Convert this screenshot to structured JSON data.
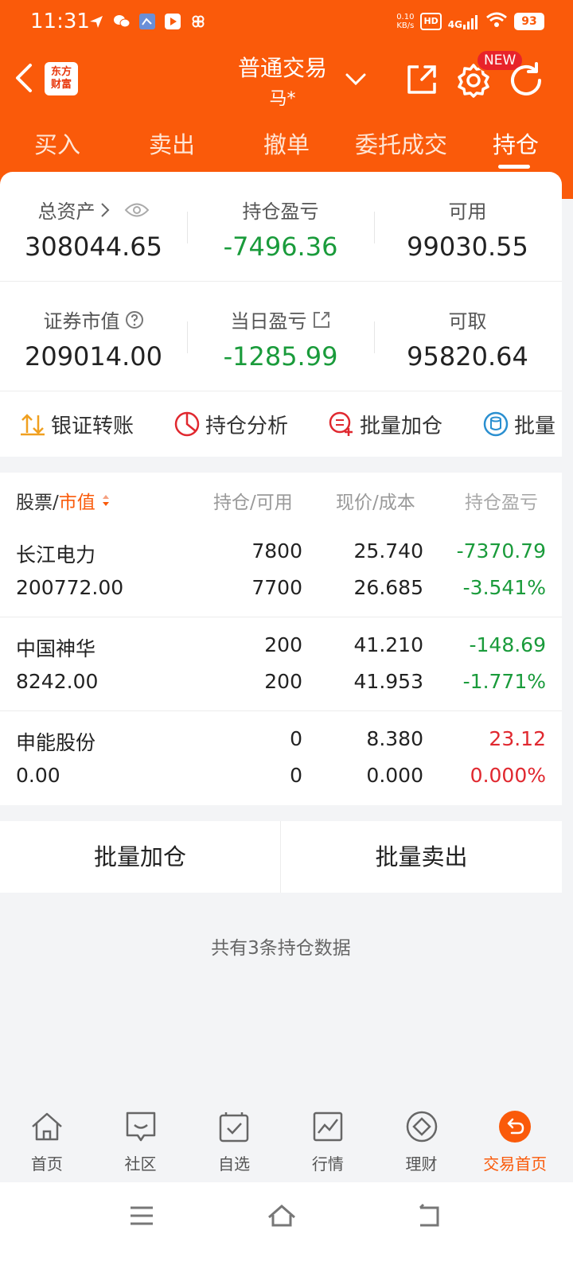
{
  "status": {
    "time": "11:31",
    "net_speed_value": "0.10",
    "net_speed_unit": "KB/s",
    "hd": "HD",
    "network": "4G",
    "battery": "93"
  },
  "nav": {
    "logo_line1": "东方",
    "logo_line2": "财富",
    "title": "普通交易",
    "subtitle": "马*",
    "new_badge": "NEW"
  },
  "tabs": [
    {
      "label": "买入"
    },
    {
      "label": "卖出"
    },
    {
      "label": "撤单"
    },
    {
      "label": "委托成交"
    },
    {
      "label": "持仓"
    }
  ],
  "assets": {
    "total_label": "总资产",
    "total_value": "308044.65",
    "pl_label": "持仓盈亏",
    "pl_value": "-7496.36",
    "available_label": "可用",
    "available_value": "99030.55",
    "market_label": "证券市值",
    "market_value": "209014.00",
    "daily_label": "当日盈亏",
    "daily_value": "-1285.99",
    "withdraw_label": "可取",
    "withdraw_value": "95820.64"
  },
  "quick_actions": [
    {
      "label": "银证转账"
    },
    {
      "label": "持仓分析"
    },
    {
      "label": "批量加仓"
    },
    {
      "label": "批量"
    }
  ],
  "holdings_header": {
    "stock": "股票",
    "slash": "/",
    "market_value": "市值",
    "qty": "持仓/可用",
    "price": "现价/成本",
    "pl": "持仓盈亏"
  },
  "holdings": [
    {
      "name": "长江电力",
      "market_value": "200772.00",
      "qty": "7800",
      "available": "7700",
      "price": "25.740",
      "cost": "26.685",
      "pl": "-7370.79",
      "pl_pct": "-3.541%"
    },
    {
      "name": "中国神华",
      "market_value": "8242.00",
      "qty": "200",
      "available": "200",
      "price": "41.210",
      "cost": "41.953",
      "pl": "-148.69",
      "pl_pct": "-1.771%"
    },
    {
      "name": "申能股份",
      "market_value": "0.00",
      "qty": "0",
      "available": "0",
      "price": "8.380",
      "cost": "0.000",
      "pl": "23.12",
      "pl_pct": "0.000%"
    }
  ],
  "batch": {
    "add": "批量加仓",
    "sell": "批量卖出"
  },
  "summary": "共有3条持仓数据",
  "bottom_nav": [
    {
      "label": "首页",
      "icon": "home-icon"
    },
    {
      "label": "社区",
      "icon": "community-icon"
    },
    {
      "label": "自选",
      "icon": "watchlist-icon"
    },
    {
      "label": "行情",
      "icon": "market-icon"
    },
    {
      "label": "理财",
      "icon": "wealth-icon"
    },
    {
      "label": "交易首页",
      "icon": "trade-icon"
    }
  ],
  "colors": {
    "brand": "#fa5a0a",
    "loss": "#1a9b3b",
    "gain": "#e0282f"
  }
}
